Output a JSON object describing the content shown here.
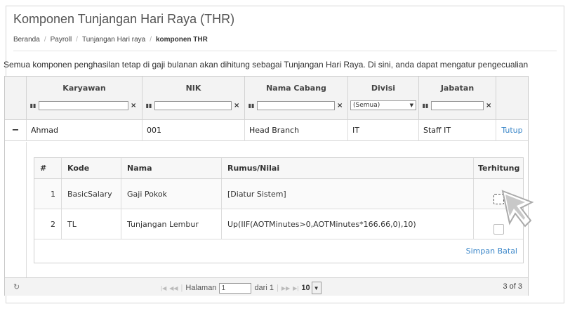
{
  "page": {
    "title": "Komponen Tunjangan Hari Raya (THR)",
    "breadcrumb": [
      "Beranda",
      "Payroll",
      "Tunjangan Hari raya",
      "komponen THR"
    ],
    "description": "Semua komponen penghasilan tetap di gaji bulanan akan dihitung sebagai Tunjangan Hari Raya. Di sini, anda dapat mengatur pengecualian"
  },
  "grid": {
    "columns": [
      "Karyawan",
      "NIK",
      "Nama Cabang",
      "Divisi",
      "Jabatan"
    ],
    "filters": {
      "karyawan": "",
      "nik": "",
      "nama_cabang": "",
      "divisi": "(Semua)",
      "jabatan": ""
    },
    "row": {
      "collapse": "−",
      "karyawan": "Ahmad",
      "nik": "001",
      "nama_cabang": "Head Branch",
      "divisi": "IT",
      "jabatan": "Staff IT",
      "action": "Tutup"
    },
    "sub": {
      "columns": [
        "#",
        "Kode",
        "Nama",
        "Rumus/Nilai",
        "Terhitung"
      ],
      "rows": [
        {
          "no": "1",
          "kode": "BasicSalary",
          "nama": "Gaji Pokok",
          "rumus": "[Diatur Sistem]",
          "terhitung": false
        },
        {
          "no": "2",
          "kode": "TL",
          "nama": "Tunjangan Lembur",
          "rumus": "Up(IIF(AOTMinutes>0,AOTMinutes*166.66,0),10)",
          "terhitung": false
        }
      ],
      "save": "Simpan",
      "cancel": "Batal"
    },
    "pager": {
      "page_label": "Halaman",
      "page_value": "1",
      "of_label": "dari 1",
      "page_size": "10",
      "count": "3 of 3"
    }
  },
  "icons": {
    "refresh": "refresh-icon",
    "filter": "filter-icon",
    "cursor": "mouse-pointer-icon"
  }
}
